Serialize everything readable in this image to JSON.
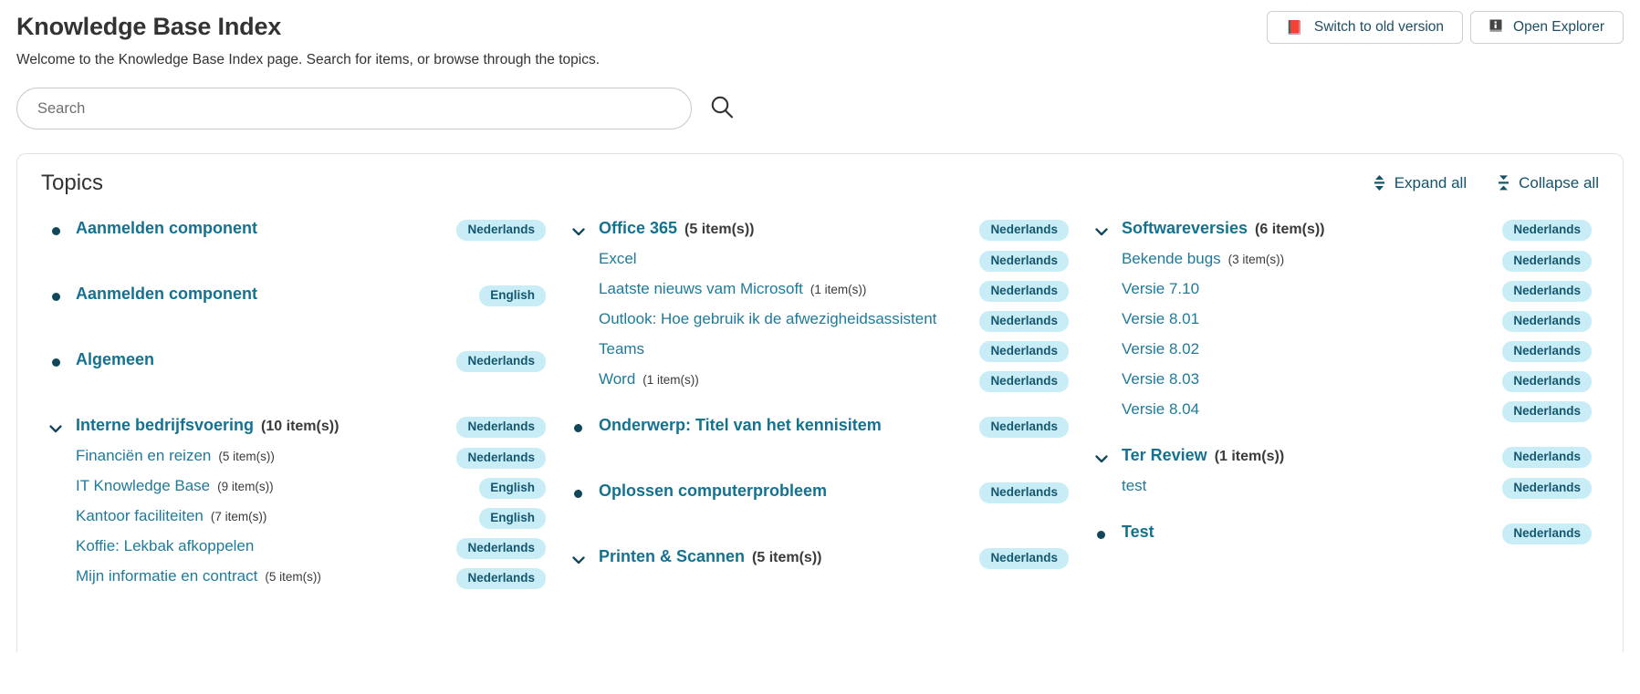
{
  "header": {
    "title": "Knowledge Base Index",
    "subtitle": "Welcome to the Knowledge Base Index page. Search for items, or browse through the topics.",
    "buttons": [
      {
        "label": "Switch to old version",
        "icon": "closed-book-icon",
        "glyph": "📕"
      },
      {
        "label": "Open Explorer",
        "icon": "information-book-icon",
        "glyph": "ℹ"
      }
    ]
  },
  "search": {
    "placeholder": "Search",
    "value": "",
    "icon": "search-icon"
  },
  "topics": {
    "title": "Topics",
    "expand_label": "Expand all",
    "collapse_label": "Collapse all",
    "expand_icon": "expand-vertical-icon",
    "collapse_icon": "collapse-vertical-icon"
  },
  "colors": {
    "link": "#15728f",
    "child_link": "#1f7a99",
    "badge_bg": "#c9edf6",
    "badge_text": "#14576e",
    "tool_text": "#13536b",
    "bullet": "#10475c"
  },
  "columns": [
    {
      "nodes": [
        {
          "label": "Aanmelden component",
          "count": "",
          "badge": "Nederlands",
          "marker": "bullet",
          "children": []
        },
        {
          "label": "Aanmelden component",
          "count": "",
          "badge": "English",
          "marker": "bullet",
          "children": []
        },
        {
          "label": "Algemeen",
          "count": "",
          "badge": "Nederlands",
          "marker": "bullet",
          "children": []
        },
        {
          "label": "Interne bedrijfsvoering",
          "count": "(10 item(s))",
          "badge": "Nederlands",
          "marker": "chevron-down",
          "children": [
            {
              "label": "Financiën en reizen",
              "count": "(5 item(s))",
              "badge": "Nederlands"
            },
            {
              "label": "IT Knowledge Base",
              "count": "(9 item(s))",
              "badge": "English"
            },
            {
              "label": "Kantoor faciliteiten",
              "count": "(7 item(s))",
              "badge": "English"
            },
            {
              "label": "Koffie: Lekbak afkoppelen",
              "count": "",
              "badge": "Nederlands"
            },
            {
              "label": "Mijn informatie en contract",
              "count": "(5 item(s))",
              "badge": "Nederlands"
            }
          ]
        }
      ]
    },
    {
      "nodes": [
        {
          "label": "Office 365",
          "count": "(5 item(s))",
          "badge": "Nederlands",
          "marker": "chevron-down",
          "children": [
            {
              "label": "Excel",
              "count": "",
              "badge": "Nederlands"
            },
            {
              "label": "Laatste nieuws vam Microsoft",
              "count": "(1 item(s))",
              "badge": "Nederlands"
            },
            {
              "label": "Outlook: Hoe gebruik ik de afwezigheidsassistent",
              "count": "",
              "badge": "Nederlands"
            },
            {
              "label": "Teams",
              "count": "",
              "badge": "Nederlands"
            },
            {
              "label": "Word",
              "count": "(1 item(s))",
              "badge": "Nederlands"
            }
          ]
        },
        {
          "label": "Onderwerp: Titel van het kennisitem",
          "count": "",
          "badge": "Nederlands",
          "marker": "bullet",
          "children": []
        },
        {
          "label": "Oplossen computerprobleem",
          "count": "",
          "badge": "Nederlands",
          "marker": "bullet",
          "children": []
        },
        {
          "label": "Printen & Scannen",
          "count": "(5 item(s))",
          "badge": "Nederlands",
          "marker": "chevron-down",
          "children": []
        }
      ]
    },
    {
      "nodes": [
        {
          "label": "Softwareversies",
          "count": "(6 item(s))",
          "badge": "Nederlands",
          "marker": "chevron-down",
          "children": [
            {
              "label": "Bekende bugs",
              "count": "(3 item(s))",
              "badge": "Nederlands"
            },
            {
              "label": "Versie 7.10",
              "count": "",
              "badge": "Nederlands"
            },
            {
              "label": "Versie 8.01",
              "count": "",
              "badge": "Nederlands"
            },
            {
              "label": "Versie 8.02",
              "count": "",
              "badge": "Nederlands"
            },
            {
              "label": "Versie 8.03",
              "count": "",
              "badge": "Nederlands"
            },
            {
              "label": "Versie 8.04",
              "count": "",
              "badge": "Nederlands"
            }
          ]
        },
        {
          "label": "Ter Review",
          "count": "(1 item(s))",
          "badge": "Nederlands",
          "marker": "chevron-down",
          "children": [
            {
              "label": "test",
              "count": "",
              "badge": "Nederlands"
            }
          ]
        },
        {
          "label": "Test",
          "count": "",
          "badge": "Nederlands",
          "marker": "bullet",
          "children": []
        }
      ]
    }
  ]
}
